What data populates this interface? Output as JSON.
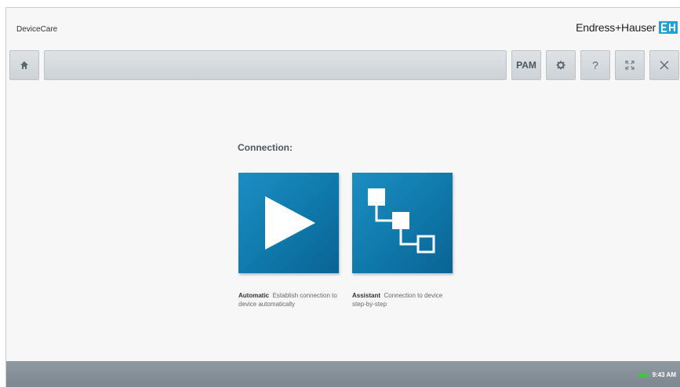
{
  "app": {
    "title": "DeviceCare"
  },
  "brand": {
    "name": "Endress+Hauser",
    "logo_text": "E+H",
    "logo_color": "#1da1e0"
  },
  "toolbar": {
    "home_icon": "home-icon",
    "pam_label": "PAM",
    "settings_icon": "gear-icon",
    "help_label": "?",
    "fullscreen_icon": "fullscreen-icon",
    "close_icon": "close-icon"
  },
  "main": {
    "connection_label": "Connection:",
    "tiles": [
      {
        "name": "Automatic",
        "description": "Establish connection to device automatically",
        "icon": "play-icon"
      },
      {
        "name": "Assistant",
        "description": "Connection to device step-by-step",
        "icon": "steps-icon"
      }
    ],
    "tile_color": "#1485ba"
  },
  "status": {
    "time": "9:43 AM",
    "battery_icon": "battery-icon",
    "battery_color": "#46c14a"
  }
}
